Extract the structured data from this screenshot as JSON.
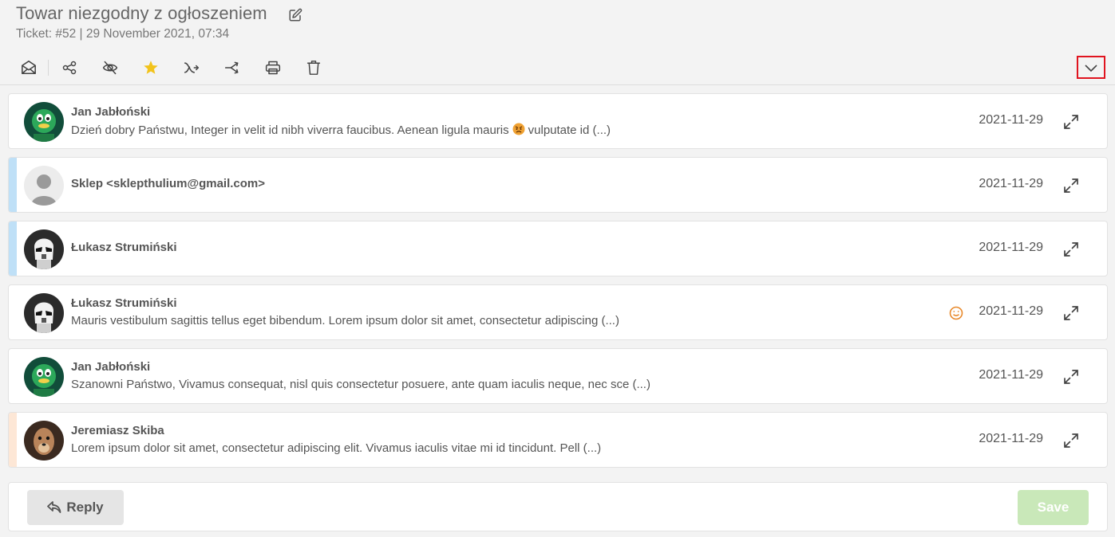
{
  "header": {
    "title": "Towar niezgodny z ogłoszeniem",
    "subtitle": "Ticket: #52 | 29 November 2021, 07:34"
  },
  "toolbar": {
    "icons": [
      "envelope-icon",
      "share-icon",
      "eye-slash-icon",
      "star-icon",
      "forward-icon",
      "merge-icon",
      "print-icon",
      "trash-icon"
    ],
    "star_color": "#f2c31b",
    "collapse_icon": "chevron-down-icon",
    "highlight_color": "#e0141f"
  },
  "messages": [
    {
      "sender": "Jan Jabłoński",
      "preview_before_emoji": "Dzień dobry Państwu, Integer in velit id nibh viverra faucibus. Aenean ligula mauris",
      "preview_after_emoji": "vulputate id (...)",
      "date": "2021-11-29",
      "accent": null,
      "avatar": "green-mascot-avatar"
    },
    {
      "sender": "Sklep <sklepthulium@gmail.com>",
      "preview": "",
      "date": "2021-11-29",
      "accent": "#bfe0f7",
      "avatar": "default-user-avatar"
    },
    {
      "sender": "Łukasz Strumiński",
      "preview": "",
      "date": "2021-11-29",
      "accent": "#bfe0f7",
      "avatar": "stormtrooper-avatar"
    },
    {
      "sender": "Łukasz Strumiński",
      "preview": "Mauris vestibulum sagittis tellus eget bibendum. Lorem ipsum dolor sit amet, consectetur adipiscing (...)",
      "date": "2021-11-29",
      "accent": null,
      "avatar": "stormtrooper-avatar",
      "sentiment": "smile-icon"
    },
    {
      "sender": "Jan Jabłoński",
      "preview": "Szanowni Państwo, Vivamus consequat, nisl quis consectetur posuere, ante quam iaculis neque, nec sce (...)",
      "date": "2021-11-29",
      "accent": null,
      "avatar": "green-mascot-avatar"
    },
    {
      "sender": "Jeremiasz Skiba",
      "preview": "Lorem ipsum dolor sit amet, consectetur adipiscing elit. Vivamus iaculis vitae mi id tincidunt. Pell (...)",
      "date": "2021-11-29",
      "accent": "#fde7d6",
      "avatar": "meerkat-avatar"
    }
  ],
  "footer": {
    "reply_label": "Reply",
    "save_label": "Save",
    "save_color": "#c9e8b9"
  }
}
